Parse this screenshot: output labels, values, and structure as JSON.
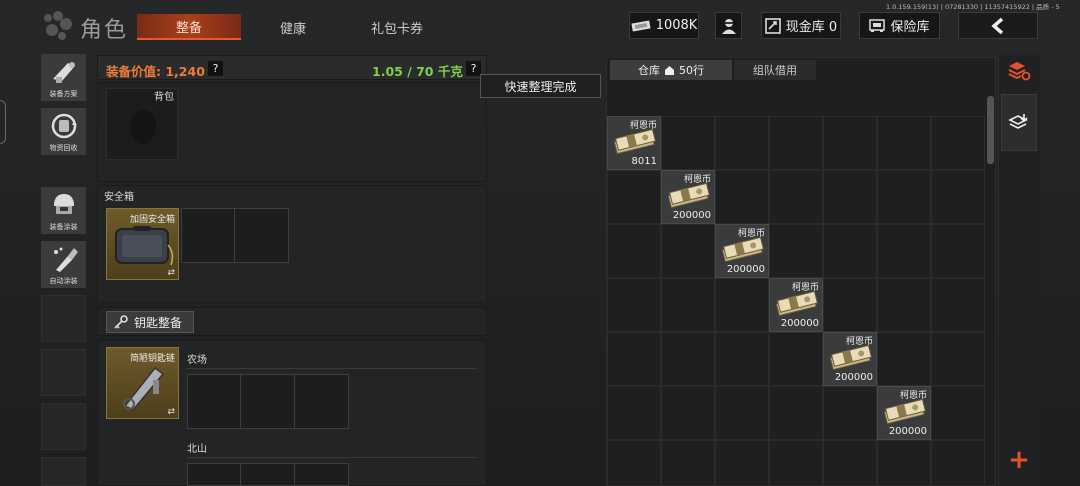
{
  "version_info": "1.0.159.159(13) | 07281330 | 11357415922 | 品质 - 5",
  "header": {
    "title": "角色",
    "tabs": [
      "整备",
      "健康",
      "礼包卡券"
    ],
    "currency": "1008K",
    "cash_label": "现金库 0",
    "vault_label": "保险库"
  },
  "sidebar": {
    "items": [
      "装备方案",
      "物资回收",
      "装备涂装",
      "自动涂装"
    ]
  },
  "equipment": {
    "value_label": "装备价值: 1,240",
    "weight": "1.05 / 70 千克",
    "help": "?",
    "backpack_label": "背包",
    "safebox_label": "安全箱",
    "safebox_item": "加固安全箱",
    "key_button": "钥匙整备",
    "keychain_item": "简陋钥匙链",
    "key_area_1": "农场",
    "key_area_2": "北山"
  },
  "toast": "快速整理完成",
  "warehouse": {
    "tab_label": "仓库",
    "rows": "50行",
    "team_tab": "组队借用",
    "items": [
      {
        "name": "柯恩币",
        "qty": "8011"
      },
      {
        "name": "柯恩币",
        "qty": "200000"
      },
      {
        "name": "柯恩币",
        "qty": "200000"
      },
      {
        "name": "柯恩币",
        "qty": "200000"
      },
      {
        "name": "柯恩币",
        "qty": "200000"
      },
      {
        "name": "柯恩币",
        "qty": "200000"
      }
    ]
  },
  "right_tools": {
    "add": "+"
  },
  "colors": {
    "accent": "#e8502a",
    "value_orange": "#f07a3a",
    "weight_green": "#7fd04a"
  }
}
